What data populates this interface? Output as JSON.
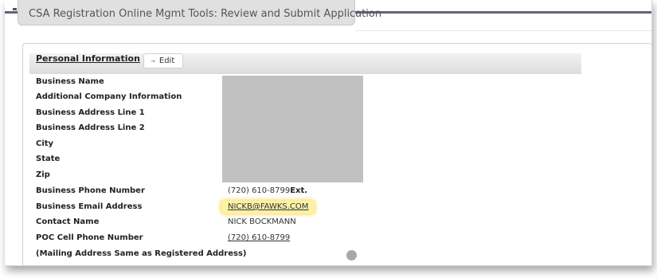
{
  "header": {
    "title": "CSA Registration Online Mgmt Tools: Review and Submit Application"
  },
  "section": {
    "title": "Personal Information",
    "edit_label": "Edit"
  },
  "fields": {
    "business_name": {
      "label": "Business Name"
    },
    "additional_info": {
      "label": "Additional Company Information"
    },
    "address_line1": {
      "label": "Business Address Line 1"
    },
    "address_line2": {
      "label": "Business Address Line 2"
    },
    "city": {
      "label": "City"
    },
    "state": {
      "label": "State"
    },
    "zip": {
      "label": "Zip"
    },
    "business_phone": {
      "label": "Business Phone Number",
      "value": "(720) 610-8799",
      "ext_label": "Ext."
    },
    "business_email": {
      "label": "Business Email Address",
      "value": "NICKB@FAWKS.COM"
    },
    "contact_name": {
      "label": "Contact Name",
      "value": "NICK BOCKMANN"
    },
    "poc_cell": {
      "label": "POC Cell Phone Number",
      "value": "(720) 610-8799"
    },
    "mailing_same": {
      "label": "(Mailing Address Same as Registered Address)"
    }
  },
  "colors": {
    "highlight": "#fdf1a8",
    "redaction": "#c1c1c1",
    "header_rule": "#6a6079"
  }
}
